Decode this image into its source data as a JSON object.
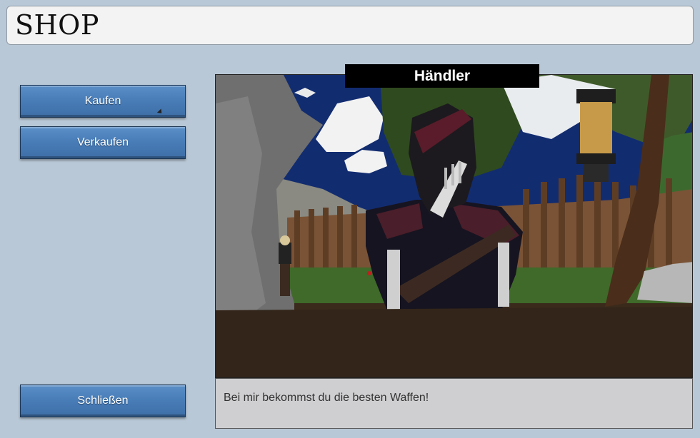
{
  "header": {
    "title": "SHOP"
  },
  "menu": {
    "buy_label": "Kaufen",
    "sell_label": "Verkaufen",
    "close_label": "Schließen"
  },
  "npc": {
    "name": "Händler",
    "dialog": "Bei mir bekommst du die besten Waffen!"
  },
  "colors": {
    "background": "#b9c8d6",
    "button": "#4a7fba",
    "name_plate": "#000000",
    "dialog_box": "#cfcfd1"
  }
}
